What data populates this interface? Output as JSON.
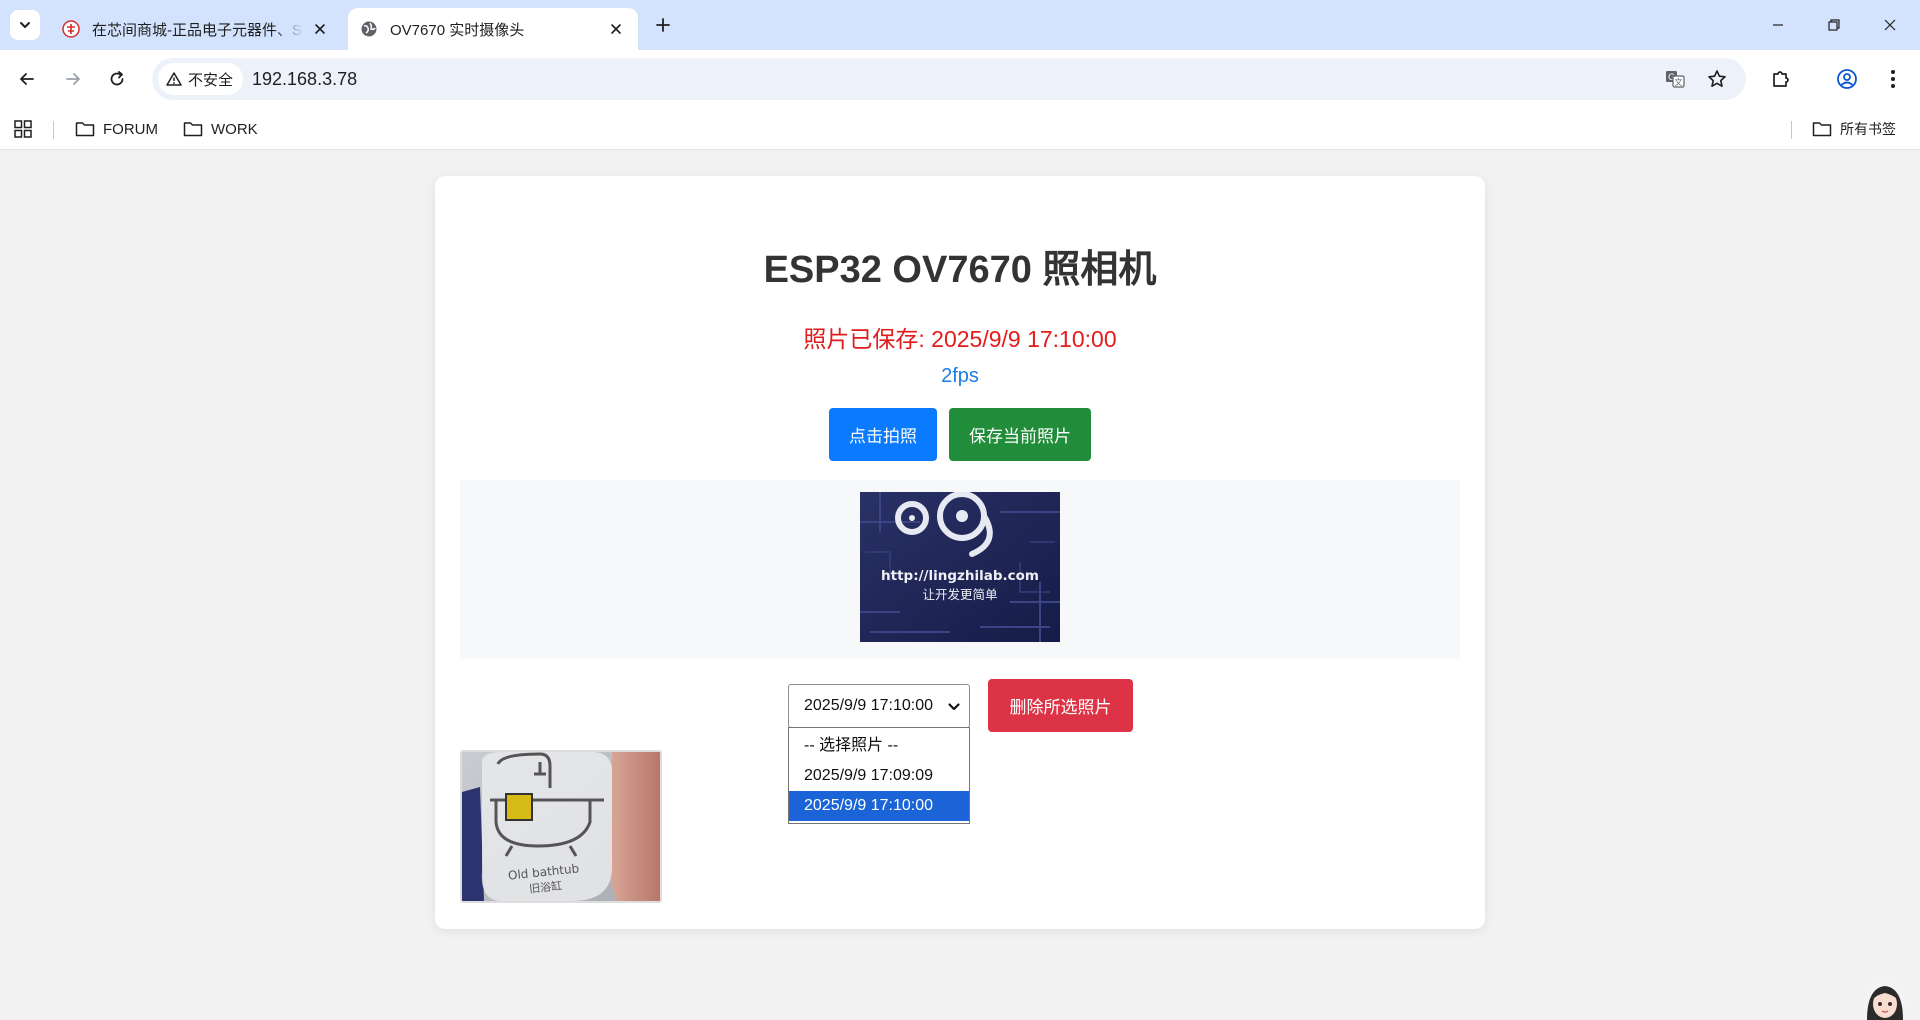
{
  "browser": {
    "tabs": [
      {
        "title": "在芯间商城-正品电子元器件、S",
        "active": false
      },
      {
        "title": "OV7670 实时摄像头",
        "active": true
      }
    ],
    "address": {
      "security_label": "不安全",
      "url": "192.168.3.78"
    },
    "bookmarks": {
      "items": [
        {
          "label": "FORUM"
        },
        {
          "label": "WORK"
        }
      ],
      "all_bookmarks_label": "所有书签"
    }
  },
  "page": {
    "title": "ESP32 OV7670 照相机",
    "status_prefix": "照片已保存: ",
    "status_time": "2025/9/9 17:10:00",
    "fps": "2fps",
    "buttons": {
      "capture": "点击拍照",
      "save": "保存当前照片",
      "delete": "删除所选照片"
    },
    "live_preview": {
      "url_text": "http://lingzhilab.com",
      "slogan": "让开发更简单"
    },
    "photo_select": {
      "selected_value": "2025/9/9 17:10:00",
      "options": [
        "-- 选择照片 --",
        "2025/9/9 17:09:09",
        "2025/9/9 17:10:00"
      ],
      "highlighted_index": 2
    },
    "thumbnail": {
      "caption_en": "Old bathtub",
      "caption_cn": "旧浴缸"
    }
  },
  "colors": {
    "tabstrip": "#d3e3fd",
    "capture_button": "#0a7bff",
    "save_button": "#218c3a",
    "delete_button": "#dd3346",
    "status_text": "#e21b1b",
    "fps_text": "#1a7fe0",
    "dropdown_highlight": "#1a64d8"
  },
  "icons": {
    "tab_search": "chevron-down-icon",
    "inactive_tab_favicon": "shop-logo-icon",
    "active_tab_favicon": "globe-icon",
    "security": "warning-triangle-icon",
    "translate": "translate-icon",
    "bookmark_star": "star-icon",
    "extensions": "puzzle-icon",
    "profile": "profile-icon",
    "menu": "more-vertical-icon",
    "apps": "apps-grid-icon",
    "folder": "folder-icon"
  }
}
